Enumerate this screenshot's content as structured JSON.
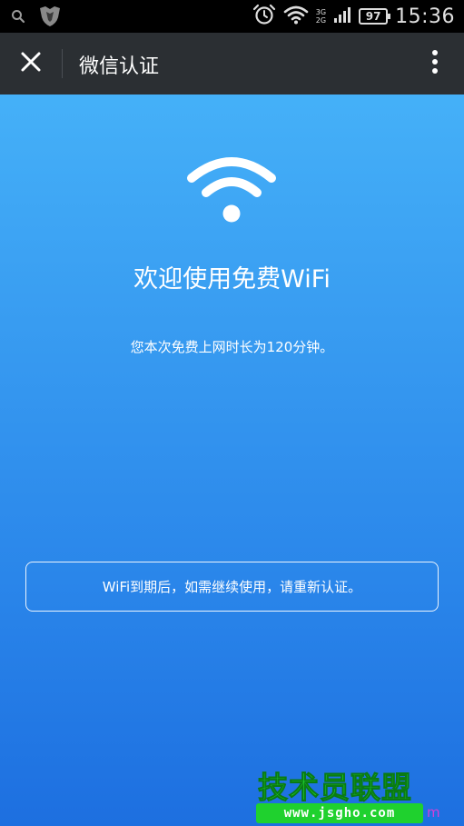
{
  "status_bar": {
    "network_top": "3G",
    "network_bottom": "2G",
    "battery": "97",
    "time": "15:36"
  },
  "app_bar": {
    "title": "微信认证"
  },
  "main": {
    "welcome": "欢迎使用免费WiFi",
    "duration_text": "您本次免费上网时长为120分钟。",
    "notice": "WiFi到期后，如需继续使用，请重新认证。"
  },
  "watermark": {
    "title": "技术员联盟",
    "url": "www.jsgho.com",
    "suffix": "m"
  },
  "colors": {
    "status_bar_bg": "#000000",
    "app_bar_bg": "#2b2f33",
    "gradient_top": "#4ab9fb",
    "gradient_bottom": "#1d6fe0",
    "watermark_green": "#22dd33"
  },
  "icons": {
    "status_left": [
      "search-icon",
      "shield-icon"
    ],
    "status_right": [
      "alarm-icon",
      "wifi-icon",
      "signal-icon",
      "battery-icon"
    ],
    "app_bar": [
      "close-icon",
      "more-vertical-icon"
    ],
    "hero": "wifi-icon"
  }
}
